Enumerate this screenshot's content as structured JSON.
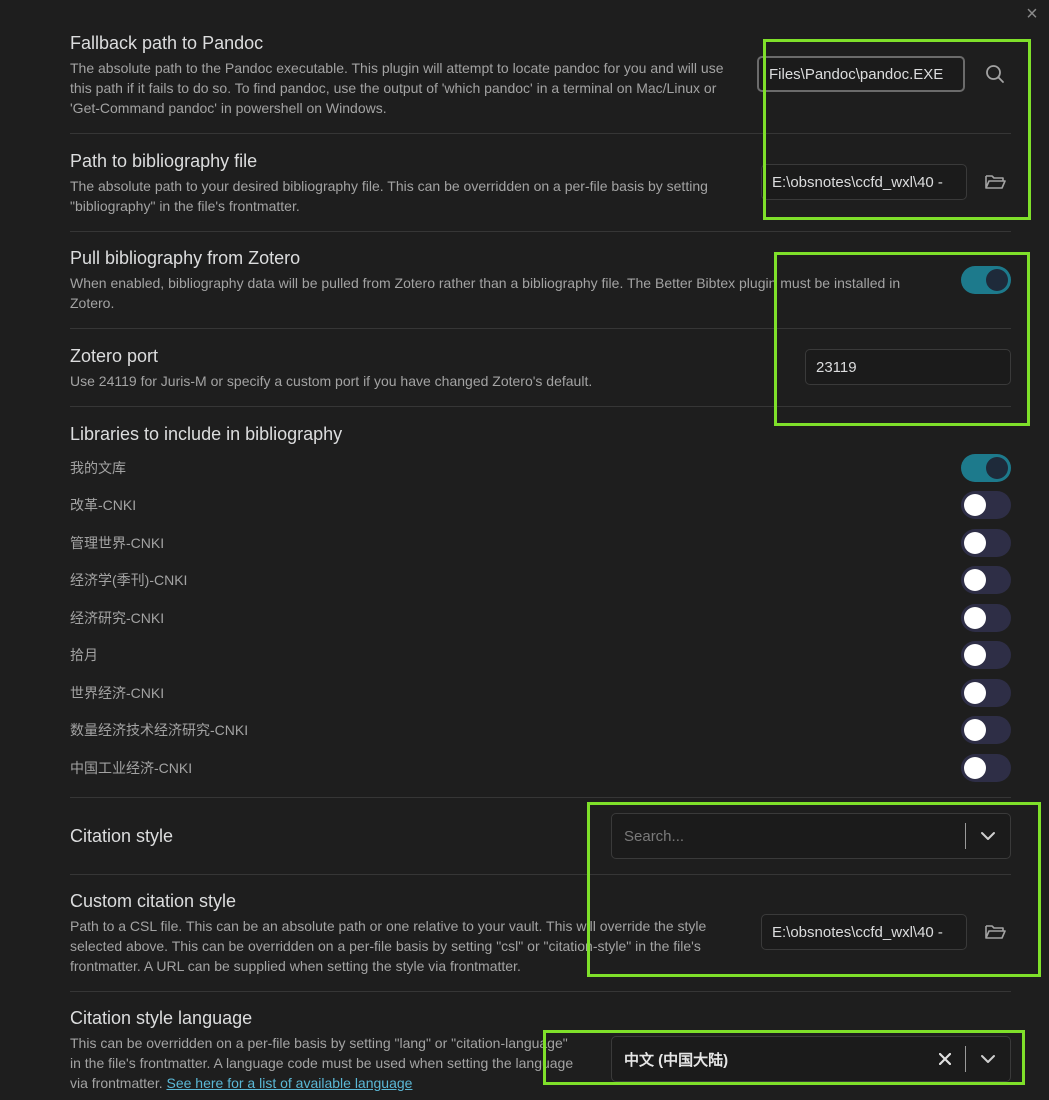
{
  "close_label": "×",
  "settings": {
    "pandoc": {
      "title": "Fallback path to Pandoc",
      "desc": "The absolute path to the Pandoc executable. This plugin will attempt to locate pandoc for you and will use this path if it fails to do so. To find pandoc, use the output of 'which pandoc' in a terminal on Mac/Linux or 'Get-Command pandoc' in powershell on Windows.",
      "value": "Files\\Pandoc\\pandoc.EXE"
    },
    "bibliography": {
      "title": "Path to bibliography file",
      "desc": "The absolute path to your desired bibliography file. This can be overridden on a per-file basis by setting \"bibliography\" in the file's frontmatter.",
      "value": "E:\\obsnotes\\ccfd_wxl\\40 -"
    },
    "zotero_pull": {
      "title": "Pull bibliography from Zotero",
      "desc": "When enabled, bibliography data will be pulled from Zotero rather than a bibliography file. The Better Bibtex plugin must be installed in Zotero.",
      "enabled": true
    },
    "zotero_port": {
      "title": "Zotero port",
      "desc": "Use 24119 for Juris-M or specify a custom port if you have changed Zotero's default.",
      "value": "23119"
    },
    "libraries": {
      "title": "Libraries to include in bibliography",
      "items": [
        {
          "label": "我的文库",
          "enabled": true
        },
        {
          "label": "改革-CNKI",
          "enabled": false
        },
        {
          "label": "管理世界-CNKI",
          "enabled": false
        },
        {
          "label": "经济学(季刊)-CNKI",
          "enabled": false
        },
        {
          "label": "经济研究-CNKI",
          "enabled": false
        },
        {
          "label": "拾月",
          "enabled": false
        },
        {
          "label": "世界经济-CNKI",
          "enabled": false
        },
        {
          "label": "数量经济技术经济研究-CNKI",
          "enabled": false
        },
        {
          "label": "中国工业经济-CNKI",
          "enabled": false
        }
      ]
    },
    "citation_style": {
      "title": "Citation style",
      "placeholder": "Search..."
    },
    "custom_citation": {
      "title": "Custom citation style",
      "desc": "Path to a CSL file. This can be an absolute path or one relative to your vault. This will override the style selected above. This can be overridden on a per-file basis by setting \"csl\" or \"citation-style\" in the file's frontmatter. A URL can be supplied when setting the style via frontmatter.",
      "value": "E:\\obsnotes\\ccfd_wxl\\40 -"
    },
    "citation_language": {
      "title": "Citation style language",
      "desc": "This can be overridden on a per-file basis by setting \"lang\" or \"citation-language\" in the file's frontmatter. A language code must be used when setting the language via frontmatter.",
      "link": "See here for a list of available language",
      "value": "中文 (中国大陆)"
    }
  },
  "colors": {
    "background": "#1e1e1e",
    "toggle_on": "#1d7a8c",
    "highlight": "#7fe02a"
  }
}
